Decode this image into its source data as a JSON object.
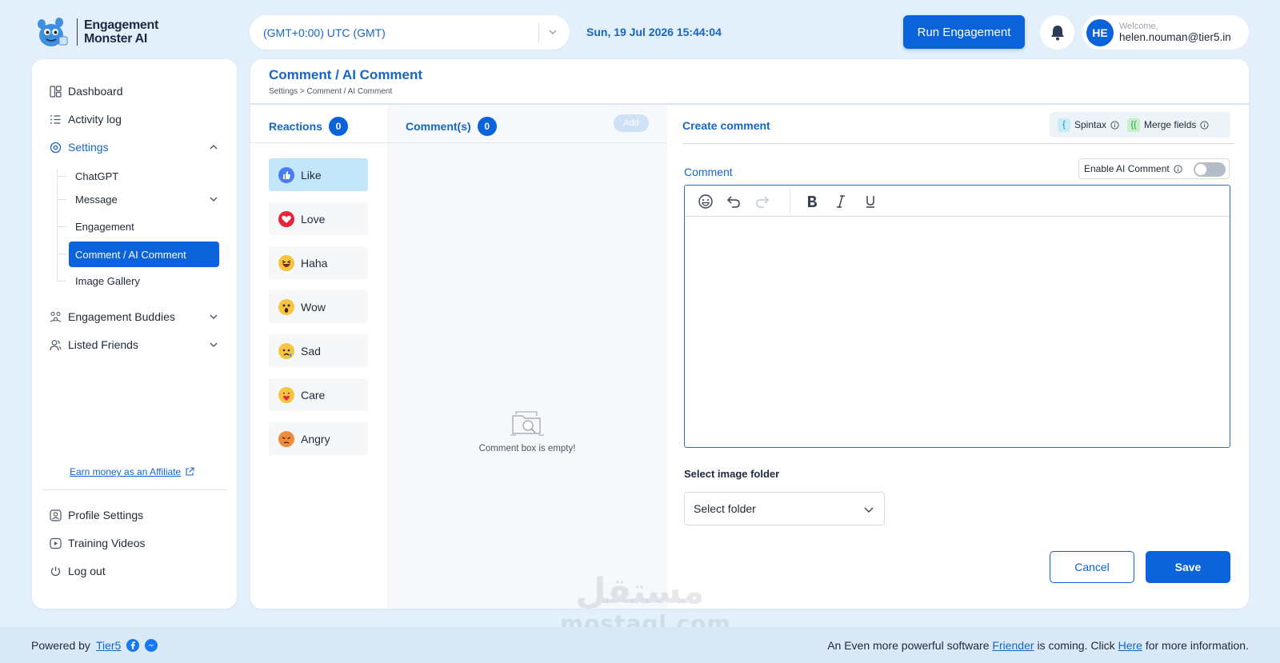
{
  "brand": {
    "line1": "Engagement",
    "line2": "Monster AI"
  },
  "timezone": {
    "value": "(GMT+0:00) UTC (GMT)"
  },
  "datetime": "Sun, 19 Jul 2026 15:44:04",
  "header": {
    "run_button": "Run Engagement",
    "welcome": "Welcome,",
    "email": "helen.nouman@tier5.in",
    "avatar_initials": "HE"
  },
  "sidebar": {
    "dashboard": "Dashboard",
    "activity_log": "Activity log",
    "settings": "Settings",
    "sub": {
      "chatgpt": "ChatGPT",
      "message": "Message",
      "engagement": "Engagement",
      "comment": "Comment / AI Comment",
      "image_gallery": "Image Gallery"
    },
    "engagement_buddies": "Engagement Buddies",
    "listed_friends": "Listed Friends",
    "affiliate": "Earn money as an Affiliate",
    "profile_settings": "Profile Settings",
    "training_videos": "Training Videos",
    "logout": "Log out"
  },
  "page": {
    "title": "Comment / AI Comment",
    "breadcrumb": "Settings > Comment / AI Comment"
  },
  "reactions": {
    "label": "Reactions",
    "count": "0",
    "items": [
      {
        "label": "Like",
        "icon": "like-icon",
        "color": "#4a7df2"
      },
      {
        "label": "Love",
        "icon": "love-icon",
        "color": "#e8233b"
      },
      {
        "label": "Haha",
        "icon": "haha-icon",
        "color": "#f6c343"
      },
      {
        "label": "Wow",
        "icon": "wow-icon",
        "color": "#f6c343"
      },
      {
        "label": "Sad",
        "icon": "sad-icon",
        "color": "#f6c343"
      },
      {
        "label": "Care",
        "icon": "care-icon",
        "color": "#f6c343"
      },
      {
        "label": "Angry",
        "icon": "angry-icon",
        "color": "#f08a3c"
      }
    ]
  },
  "comments": {
    "label": "Comment(s)",
    "count": "0",
    "add": "Add",
    "empty": "Comment box is empty!"
  },
  "create": {
    "title": "Create comment",
    "spintax_tag": "{",
    "spintax": "Spintax",
    "merge_tag": "{{",
    "merge": "Merge fields",
    "comment_label": "Comment",
    "enable_ai": "Enable AI Comment",
    "select_folder_label": "Select image folder",
    "select_folder": "Select folder",
    "cancel": "Cancel",
    "save": "Save"
  },
  "footer": {
    "powered_by": "Powered by",
    "tier5": "Tier5",
    "msg_before": "An Even more powerful software",
    "friender": "Friender",
    "msg_middle": "is coming. Click",
    "here": "Here",
    "msg_after": "for more information."
  },
  "watermark": {
    "arabic": "مستقل",
    "latin": "mostaql.com"
  },
  "colors": {
    "primary": "#0a63d8",
    "accent_text": "#1666c4",
    "background": "#e3f0fb",
    "selected_reaction": "#c3e6fb"
  }
}
